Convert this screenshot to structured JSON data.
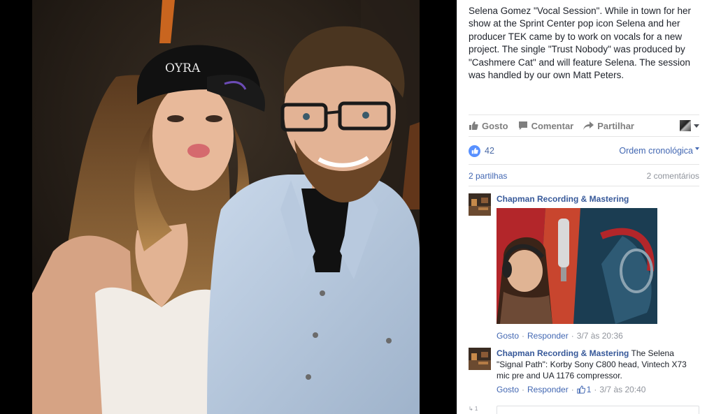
{
  "post": {
    "caption": "Selena Gomez \"Vocal Session\". While in town for her show at the Sprint Center pop icon Selena and her producer TEK came by to work on vocals for a new project. The single \"Trust Nobody\" was produced by \"Cashmere Cat\" and will feature Selena. The session was handled by our own Matt Peters.",
    "cap_text": "OYRA"
  },
  "actions": {
    "like": "Gosto",
    "comment": "Comentar",
    "share": "Partilhar"
  },
  "stats": {
    "likes": "42",
    "order": "Ordem cronológica",
    "shares": "2 partilhas",
    "comments": "2 comentários"
  },
  "comments": [
    {
      "author": "Chapman Recording & Mastering",
      "text": "",
      "like": "Gosto",
      "reply": "Responder",
      "likes": "",
      "time": "3/7 às 20:36"
    },
    {
      "author": "Chapman Recording & Mastering",
      "text": "The Selena \"Signal Path\": Korby Sony C800 head, Vintech X73 mic pre and UA 1176 compressor.",
      "like": "Gosto",
      "reply": "Responder",
      "likes": "1",
      "time": "3/7 às 20:40"
    }
  ],
  "reply_box": {
    "indicator": "↳ 1"
  },
  "colors": {
    "fb_blue": "#4267b2",
    "like_blue": "#5890ff",
    "text": "#1d2129",
    "muted": "#90949c"
  },
  "icons": [
    "thumbs-up-icon",
    "comment-icon",
    "share-arrow-icon",
    "chevron-down-icon"
  ]
}
